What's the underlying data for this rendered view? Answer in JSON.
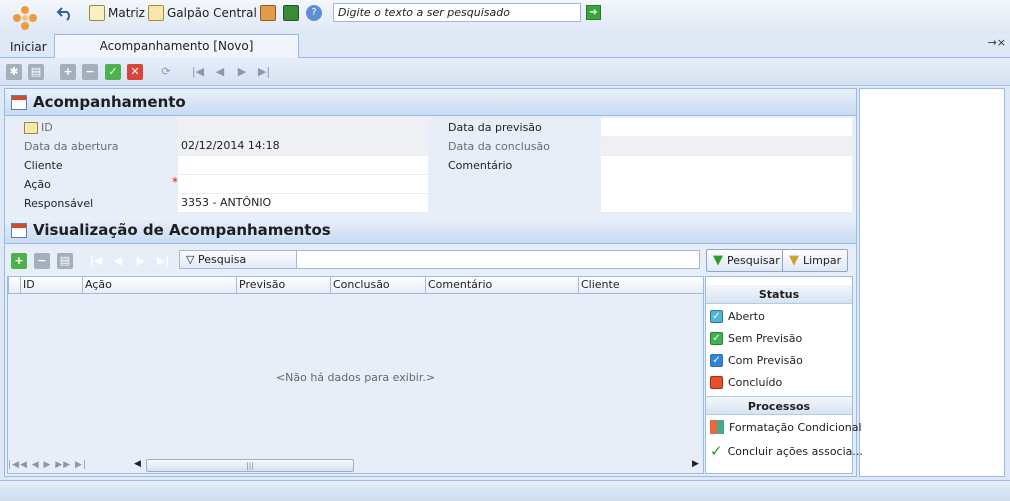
{
  "topbar": {
    "search_placeholder": "Digite o texto a ser pesquisado",
    "quick_buttons": {
      "matriz": "Matriz",
      "galpao": "Galpão Central"
    }
  },
  "tabs": {
    "start": "Iniciar",
    "document": "Acompanhamento [Novo]"
  },
  "form": {
    "title": "Acompanhamento",
    "fields": {
      "id_label": "ID",
      "abertura_label": "Data da abertura",
      "abertura_value": "02/12/2014 14:18",
      "cliente_label": "Cliente",
      "acao_label": "Ação",
      "acao_required": "*",
      "responsavel_label": "Responsável",
      "responsavel_value": "3353 - ANTÔNIO",
      "previsao_label": "Data da previsão",
      "conclusao_label": "Data da conclusão",
      "comentario_label": "Comentário"
    }
  },
  "grid": {
    "title": "Visualização de Acompanhamentos",
    "search_dropdown": "Pesquisa",
    "search_button": "Pesquisar",
    "clear_button": "Limpar",
    "columns": [
      "ID",
      "Ação",
      "Previsão",
      "Conclusão",
      "Comentário",
      "Cliente"
    ],
    "empty_text": "<Não há dados para exibir.>"
  },
  "side": {
    "status_title": "Status",
    "status_items": [
      "Aberto",
      "Sem Previsão",
      "Com Previsão",
      "Concluído"
    ],
    "processes_title": "Processos",
    "process_items": [
      "Formatação Condicional",
      "Concluir ações associa..."
    ],
    "colors": {
      "aberto": "#4fb6d6",
      "sem_previsao": "#3fb34f",
      "com_previsao": "#2f86d8",
      "concluido": "#e8502a"
    }
  }
}
